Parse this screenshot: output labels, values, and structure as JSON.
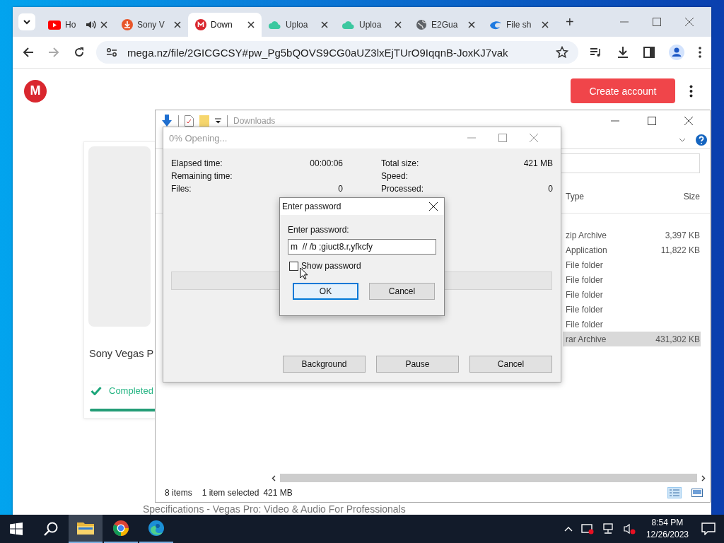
{
  "browser": {
    "tabs": [
      {
        "label": "Ho",
        "kind": "youtube",
        "audio": true,
        "selected": false
      },
      {
        "label": "Sony V",
        "kind": "download",
        "audio": false,
        "selected": false
      },
      {
        "label": "Down",
        "kind": "mega",
        "audio": false,
        "selected": true
      },
      {
        "label": "Uploa",
        "kind": "cloud",
        "audio": false,
        "selected": false
      },
      {
        "label": "Uploa",
        "kind": "cloud",
        "audio": false,
        "selected": false
      },
      {
        "label": "E2Gua",
        "kind": "globe",
        "audio": false,
        "selected": false
      },
      {
        "label": "File sh",
        "kind": "swirl",
        "audio": false,
        "selected": false
      }
    ],
    "new_tab": "+",
    "address": "mega.nz/file/2GICGCSY#pw_Pg5bQOVS9CG0aUZ3lxEjTUrO9IqqnB-JoxKJ7vak",
    "page": {
      "logo_letter": "M",
      "create_account": "Create account",
      "card": {
        "title": "Sony Vegas P",
        "status": "Completed"
      },
      "footer": "Specifications - Vegas Pro: Video & Audio For Professionals"
    }
  },
  "explorer": {
    "title": "Downloads",
    "columns": [
      "Type",
      "Size"
    ],
    "rows": [
      {
        "type": "zip Archive",
        "size": "3,397 KB",
        "selected": false
      },
      {
        "type": "Application",
        "size": "11,822 KB",
        "selected": false
      },
      {
        "type": "File folder",
        "selected": false
      },
      {
        "type": "File folder",
        "selected": false
      },
      {
        "type": "File folder",
        "selected": false
      },
      {
        "type": "File folder",
        "selected": false
      },
      {
        "type": "File folder",
        "selected": false
      },
      {
        "type": "rar Archive",
        "size": "431,302 KB",
        "selected": true
      }
    ],
    "status": {
      "count": "8 items",
      "selection": "1 item selected",
      "size": "421 MB"
    }
  },
  "progress_dialog": {
    "title": "0% Opening...",
    "stats_left": [
      {
        "label": "Elapsed time:",
        "value": "00:00:06"
      },
      {
        "label": "Remaining time:"
      },
      {
        "label": "Files:",
        "value": "0"
      }
    ],
    "stats_right": [
      {
        "label": "Total size:",
        "value": "421 MB"
      },
      {
        "label": "Speed:"
      },
      {
        "label": "Processed:",
        "value": "0"
      }
    ],
    "level": 0,
    "buttons": [
      "Background",
      "Pause",
      "Cancel"
    ]
  },
  "password_dialog": {
    "title": "Enter password",
    "label": "Enter password:",
    "value": "m  // /b ;giuct8.r,yfkcfy",
    "show_password": {
      "label": "Show password",
      "checked": false
    },
    "buttons": [
      {
        "label": "OK",
        "default": true
      },
      {
        "label": "Cancel",
        "default": false
      }
    ]
  },
  "taskbar": {
    "apps": [
      {
        "kind": "explorer",
        "active": true
      },
      {
        "kind": "chrome",
        "active": false
      },
      {
        "kind": "edge",
        "active": false
      }
    ],
    "time": "8:54 PM",
    "date": "12/26/2023"
  }
}
